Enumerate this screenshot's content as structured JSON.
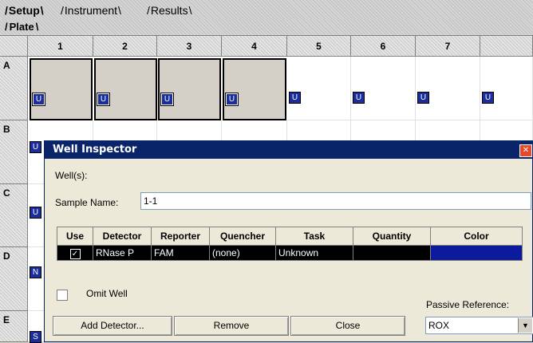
{
  "tabs": [
    "Setup",
    "Instrument",
    "Results"
  ],
  "subtab": "Plate",
  "columns": [
    "1",
    "2",
    "3",
    "4",
    "5",
    "6",
    "7"
  ],
  "rows": [
    "A",
    "B",
    "C",
    "D",
    "E"
  ],
  "row_a_tags": [
    "U",
    "U",
    "U",
    "U",
    "U",
    "U",
    "U",
    "U"
  ],
  "row_col1_tags": {
    "B": "U",
    "C": "U",
    "D": "N",
    "E": "S"
  },
  "dialog": {
    "title": "Well Inspector",
    "wells_label": "Well(s):",
    "sample_name_label": "Sample Name:",
    "sample_name_value": "1-1",
    "table_headers": [
      "Use",
      "Detector",
      "Reporter",
      "Quencher",
      "Task",
      "Quantity",
      "Color"
    ],
    "row": {
      "use": "checked",
      "detector": "RNase P",
      "reporter": "FAM",
      "quencher": "(none)",
      "task": "Unknown",
      "quantity": "",
      "color": "#0b1b9c"
    },
    "omit_label": "Omit Well",
    "passive_label": "Passive Reference:",
    "passive_value": "ROX",
    "add_detector": "Add Detector...",
    "remove": "Remove",
    "close": "Close"
  }
}
